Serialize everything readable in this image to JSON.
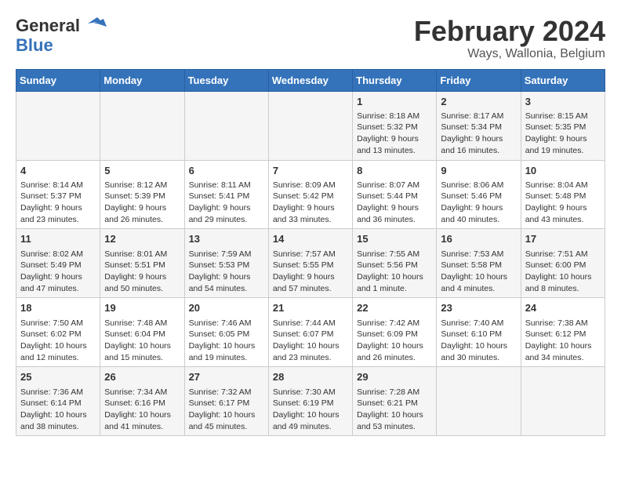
{
  "logo": {
    "line1": "General",
    "line2": "Blue"
  },
  "title": "February 2024",
  "location": "Ways, Wallonia, Belgium",
  "days_header": [
    "Sunday",
    "Monday",
    "Tuesday",
    "Wednesday",
    "Thursday",
    "Friday",
    "Saturday"
  ],
  "weeks": [
    [
      {
        "day": "",
        "content": ""
      },
      {
        "day": "",
        "content": ""
      },
      {
        "day": "",
        "content": ""
      },
      {
        "day": "",
        "content": ""
      },
      {
        "day": "1",
        "content": "Sunrise: 8:18 AM\nSunset: 5:32 PM\nDaylight: 9 hours\nand 13 minutes."
      },
      {
        "day": "2",
        "content": "Sunrise: 8:17 AM\nSunset: 5:34 PM\nDaylight: 9 hours\nand 16 minutes."
      },
      {
        "day": "3",
        "content": "Sunrise: 8:15 AM\nSunset: 5:35 PM\nDaylight: 9 hours\nand 19 minutes."
      }
    ],
    [
      {
        "day": "4",
        "content": "Sunrise: 8:14 AM\nSunset: 5:37 PM\nDaylight: 9 hours\nand 23 minutes."
      },
      {
        "day": "5",
        "content": "Sunrise: 8:12 AM\nSunset: 5:39 PM\nDaylight: 9 hours\nand 26 minutes."
      },
      {
        "day": "6",
        "content": "Sunrise: 8:11 AM\nSunset: 5:41 PM\nDaylight: 9 hours\nand 29 minutes."
      },
      {
        "day": "7",
        "content": "Sunrise: 8:09 AM\nSunset: 5:42 PM\nDaylight: 9 hours\nand 33 minutes."
      },
      {
        "day": "8",
        "content": "Sunrise: 8:07 AM\nSunset: 5:44 PM\nDaylight: 9 hours\nand 36 minutes."
      },
      {
        "day": "9",
        "content": "Sunrise: 8:06 AM\nSunset: 5:46 PM\nDaylight: 9 hours\nand 40 minutes."
      },
      {
        "day": "10",
        "content": "Sunrise: 8:04 AM\nSunset: 5:48 PM\nDaylight: 9 hours\nand 43 minutes."
      }
    ],
    [
      {
        "day": "11",
        "content": "Sunrise: 8:02 AM\nSunset: 5:49 PM\nDaylight: 9 hours\nand 47 minutes."
      },
      {
        "day": "12",
        "content": "Sunrise: 8:01 AM\nSunset: 5:51 PM\nDaylight: 9 hours\nand 50 minutes."
      },
      {
        "day": "13",
        "content": "Sunrise: 7:59 AM\nSunset: 5:53 PM\nDaylight: 9 hours\nand 54 minutes."
      },
      {
        "day": "14",
        "content": "Sunrise: 7:57 AM\nSunset: 5:55 PM\nDaylight: 9 hours\nand 57 minutes."
      },
      {
        "day": "15",
        "content": "Sunrise: 7:55 AM\nSunset: 5:56 PM\nDaylight: 10 hours\nand 1 minute."
      },
      {
        "day": "16",
        "content": "Sunrise: 7:53 AM\nSunset: 5:58 PM\nDaylight: 10 hours\nand 4 minutes."
      },
      {
        "day": "17",
        "content": "Sunrise: 7:51 AM\nSunset: 6:00 PM\nDaylight: 10 hours\nand 8 minutes."
      }
    ],
    [
      {
        "day": "18",
        "content": "Sunrise: 7:50 AM\nSunset: 6:02 PM\nDaylight: 10 hours\nand 12 minutes."
      },
      {
        "day": "19",
        "content": "Sunrise: 7:48 AM\nSunset: 6:04 PM\nDaylight: 10 hours\nand 15 minutes."
      },
      {
        "day": "20",
        "content": "Sunrise: 7:46 AM\nSunset: 6:05 PM\nDaylight: 10 hours\nand 19 minutes."
      },
      {
        "day": "21",
        "content": "Sunrise: 7:44 AM\nSunset: 6:07 PM\nDaylight: 10 hours\nand 23 minutes."
      },
      {
        "day": "22",
        "content": "Sunrise: 7:42 AM\nSunset: 6:09 PM\nDaylight: 10 hours\nand 26 minutes."
      },
      {
        "day": "23",
        "content": "Sunrise: 7:40 AM\nSunset: 6:10 PM\nDaylight: 10 hours\nand 30 minutes."
      },
      {
        "day": "24",
        "content": "Sunrise: 7:38 AM\nSunset: 6:12 PM\nDaylight: 10 hours\nand 34 minutes."
      }
    ],
    [
      {
        "day": "25",
        "content": "Sunrise: 7:36 AM\nSunset: 6:14 PM\nDaylight: 10 hours\nand 38 minutes."
      },
      {
        "day": "26",
        "content": "Sunrise: 7:34 AM\nSunset: 6:16 PM\nDaylight: 10 hours\nand 41 minutes."
      },
      {
        "day": "27",
        "content": "Sunrise: 7:32 AM\nSunset: 6:17 PM\nDaylight: 10 hours\nand 45 minutes."
      },
      {
        "day": "28",
        "content": "Sunrise: 7:30 AM\nSunset: 6:19 PM\nDaylight: 10 hours\nand 49 minutes."
      },
      {
        "day": "29",
        "content": "Sunrise: 7:28 AM\nSunset: 6:21 PM\nDaylight: 10 hours\nand 53 minutes."
      },
      {
        "day": "",
        "content": ""
      },
      {
        "day": "",
        "content": ""
      }
    ]
  ]
}
